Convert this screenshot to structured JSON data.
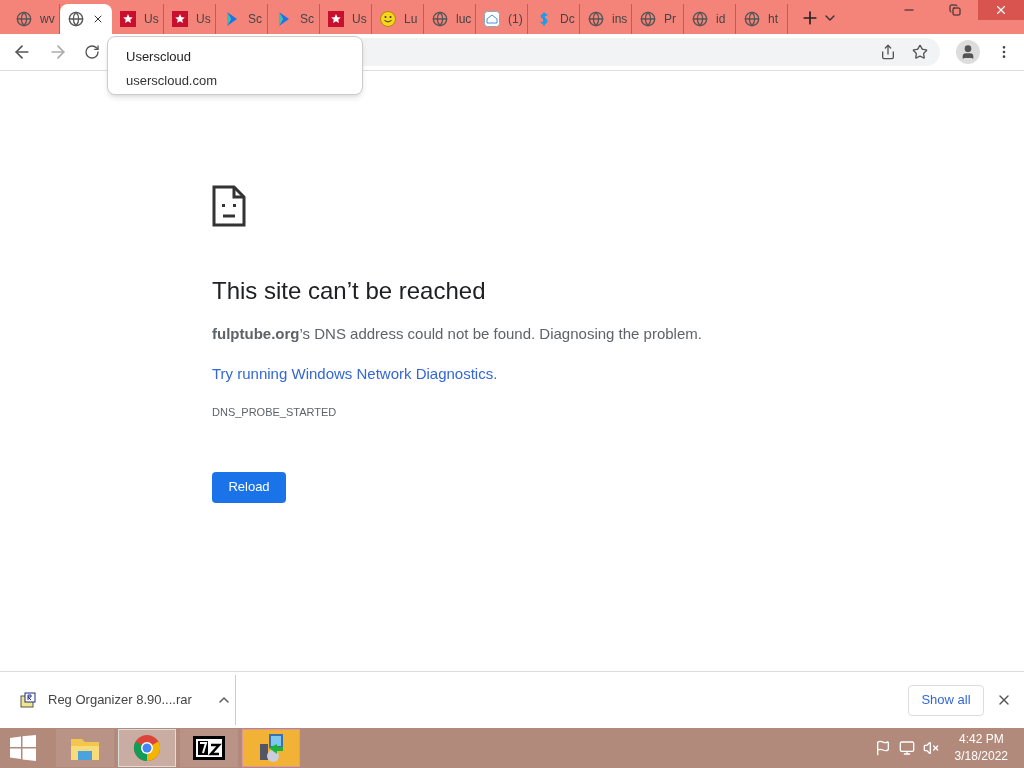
{
  "tabs": [
    {
      "kind": "globe",
      "label": "wv",
      "selected": false
    },
    {
      "kind": "globe",
      "selected": true
    },
    {
      "kind": "star",
      "label": "Us",
      "selected": false
    },
    {
      "kind": "star",
      "label": "Us",
      "selected": false
    },
    {
      "kind": "play",
      "label": "Sc",
      "selected": false
    },
    {
      "kind": "play",
      "label": "Sc",
      "selected": false
    },
    {
      "kind": "star",
      "label": "Us",
      "selected": false
    },
    {
      "kind": "smiley",
      "label": "Lu",
      "selected": false
    },
    {
      "kind": "globe",
      "label": "luc",
      "selected": false
    },
    {
      "kind": "home",
      "label": "(1)",
      "selected": false
    },
    {
      "kind": "dollar",
      "label": "Dc",
      "selected": false
    },
    {
      "kind": "globe",
      "label": "ins",
      "selected": false
    },
    {
      "kind": "globe",
      "label": "Pr",
      "selected": false
    },
    {
      "kind": "globe",
      "label": "id",
      "selected": false
    },
    {
      "kind": "globe",
      "label": "ht",
      "selected": false
    }
  ],
  "tooltip": {
    "title": "Userscloud",
    "url": "userscloud.com"
  },
  "error": {
    "title": "This site can’t be reached",
    "message": "**fulptube.org**’s DNS address could not be found. Diagnosing the problem.",
    "link": "Try running Windows Network Diagnostics.",
    "code": "DNS_PROBE_STARTED",
    "button": "Reload"
  },
  "download": {
    "file": "Reg Organizer 8.90....rar",
    "show_all": "Show all"
  },
  "taskbar": {
    "apps": [
      {
        "kind": "folder",
        "selected": false
      },
      {
        "kind": "chrome",
        "selected": true
      },
      {
        "kind": "archiver",
        "selected": false
      },
      {
        "kind": "installer",
        "selected": true
      }
    ],
    "time": "4:42 PM",
    "date": "3/18/2022"
  }
}
